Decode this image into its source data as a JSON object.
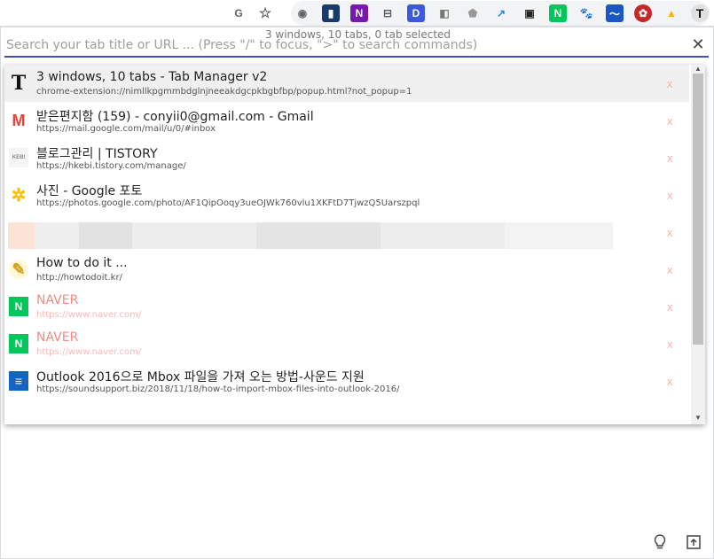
{
  "status": "3 windows, 10 tabs, 0 tab selected",
  "search": {
    "placeholder": "Search your tab title or URL ... (Press \"/\" to focus, \">\" to search commands)"
  },
  "close_label": "✕",
  "remove_label": "x",
  "tabs": [
    {
      "title": "3 windows, 10 tabs - Tab Manager v2",
      "url": "chrome-extension://nimllkpgmmbdglnjneeakdgcpkbgbfbp/popup.html?not_popup=1",
      "favicon": "T"
    },
    {
      "title": "받은편지함 (159) - conyii0@gmail.com - Gmail",
      "url": "https://mail.google.com/mail/u/0/#inbox",
      "favicon": "M"
    },
    {
      "title": "블로그관리 | TISTORY",
      "url": "https://hkebi.tistory.com/manage/",
      "favicon": "KEBI"
    },
    {
      "title": "사진 - Google 포토",
      "url": "https://photos.google.com/photo/AF1QipOoqy3ueOJWk760vlu1XKFtD7TjwzQ5Uarszpql",
      "favicon": "✲"
    },
    {
      "title": "",
      "url": "",
      "favicon": ""
    },
    {
      "title": "How to do it ...",
      "url": "http://howtodoit.kr/",
      "favicon": "✎"
    },
    {
      "title": "NAVER",
      "url": "https://www.naver.com/",
      "favicon": "N"
    },
    {
      "title": "NAVER",
      "url": "https://www.naver.com/",
      "favicon": "N"
    },
    {
      "title": "Outlook 2016으로 Mbox 파일을 가져 오는 방법-사운드 지원",
      "url": "https://soundsupport.biz/2018/11/18/how-to-import-mbox-files-into-outlook-2016/",
      "favicon": "≡"
    }
  ],
  "extensions": [
    "G",
    "☆",
    "◉",
    "▮",
    "N",
    "⊟",
    "D",
    "◧",
    "⬟",
    "↗",
    "▣",
    "N",
    "🐾",
    "〜",
    "✿",
    "▲",
    "T"
  ],
  "colors": {
    "accent": "#3f51b5",
    "duplicate": "#f28b82",
    "naver": "#03c75a"
  }
}
